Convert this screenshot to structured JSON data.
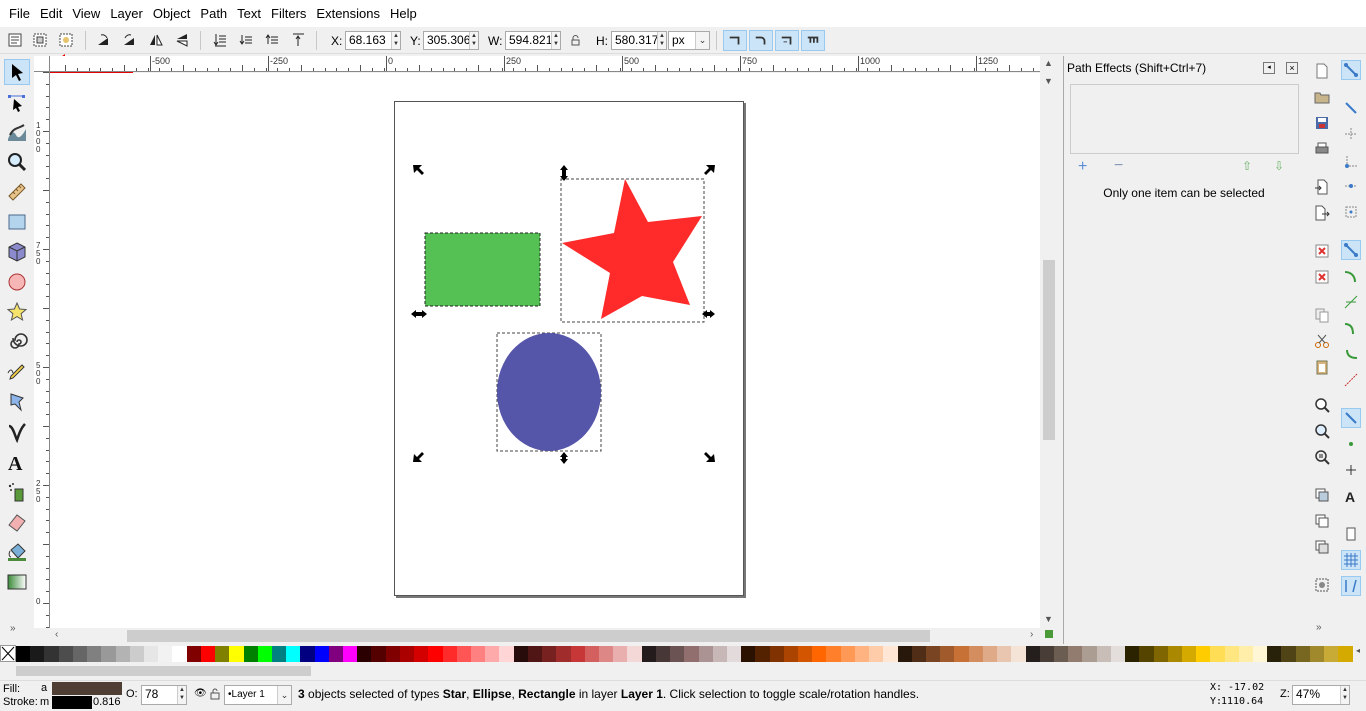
{
  "menu": [
    "File",
    "Edit",
    "View",
    "Layer",
    "Object",
    "Path",
    "Text",
    "Filters",
    "Extensions",
    "Help"
  ],
  "toolbar": {
    "x_label": "X:",
    "x_value": "68.163",
    "y_label": "Y:",
    "y_value": "305.306",
    "w_label": "W:",
    "w_value": "594.821",
    "h_label": "H:",
    "h_value": "580.317",
    "unit": "px"
  },
  "ruler": {
    "h_labels": [
      "-500",
      "-250",
      "0",
      "250",
      "500",
      "750",
      "1000",
      "1250"
    ],
    "v_labels": [
      "1000",
      "750",
      "500",
      "250",
      "0"
    ]
  },
  "canvas": {
    "rect_color": "#55c155",
    "star_color": "#ff2a2a",
    "ellipse_color": "#5555aa"
  },
  "dock": {
    "title": "Path Effects  (Shift+Ctrl+7)",
    "message": "Only one item can be selected"
  },
  "status": {
    "fill_label": "Fill:",
    "fill_value": "a",
    "stroke_label": "Stroke:",
    "stroke_value": "m",
    "stroke_width": "0.816",
    "opacity_label": "O:",
    "opacity_value": "78",
    "layer_name": "•Layer 1",
    "msg_count": "3",
    "msg_prefix": " objects selected of types ",
    "msg_t1": "Star",
    "msg_c1": ", ",
    "msg_t2": "Ellipse",
    "msg_c2": ", ",
    "msg_t3": "Rectangle",
    "msg_mid": " in layer ",
    "msg_layer": "Layer 1",
    "msg_end": ". Click selection to toggle scale/rotation handles.",
    "cursor_x_label": "X:",
    "cursor_x": "-17.02",
    "cursor_y_label": "Y:",
    "cursor_y": "1110.64",
    "zoom_label": "Z:",
    "zoom_value": "47%"
  },
  "colors": {
    "accent": "#cce4f7",
    "annotation_arrow": "#e60000",
    "fill_swatch": "#4e3e34",
    "stroke_swatch": "#000000"
  },
  "palette": [
    "#000000",
    "#1a1a1a",
    "#333333",
    "#4d4d4d",
    "#666666",
    "#808080",
    "#999999",
    "#b3b3b3",
    "#cccccc",
    "#e6e6e6",
    "#f2f2f2",
    "#ffffff",
    "#800000",
    "#ff0000",
    "#808000",
    "#ffff00",
    "#008000",
    "#00ff00",
    "#008080",
    "#00ffff",
    "#000080",
    "#0000ff",
    "#800080",
    "#ff00ff",
    "#2b0000",
    "#550000",
    "#800000",
    "#aa0000",
    "#d40000",
    "#ff0000",
    "#ff2a2a",
    "#ff5555",
    "#ff8080",
    "#ffaaaa",
    "#ffd5d5",
    "#280b0b",
    "#501616",
    "#782121",
    "#a02c2c",
    "#c83737",
    "#d35f5f",
    "#de8787",
    "#e9afaf",
    "#f4d7d7",
    "#241c1c",
    "#483737",
    "#6c5353",
    "#916f6f",
    "#ac9393",
    "#c8b7b7",
    "#e3dbdb",
    "#2b1100",
    "#552200",
    "#803300",
    "#aa4400",
    "#d45500",
    "#ff6600",
    "#ff7f2a",
    "#ff9955",
    "#ffb380",
    "#ffccaa",
    "#ffe6d5",
    "#28170b",
    "#502d16",
    "#784421",
    "#a05a2c",
    "#c87137",
    "#d38d5f",
    "#deaa87",
    "#e9c6af",
    "#f4e3d7",
    "#241f1c",
    "#483e37",
    "#6c5d53",
    "#917c6f",
    "#ac9d93",
    "#c8beb7",
    "#e3dedb",
    "#2b2200",
    "#554400",
    "#806600",
    "#aa8800",
    "#d4aa00",
    "#ffcc00",
    "#ffdd55",
    "#ffe680",
    "#ffeeaa",
    "#fff6d5",
    "#28220b",
    "#504416",
    "#786721",
    "#a0892c",
    "#c8ab37",
    "#d4aa00"
  ]
}
